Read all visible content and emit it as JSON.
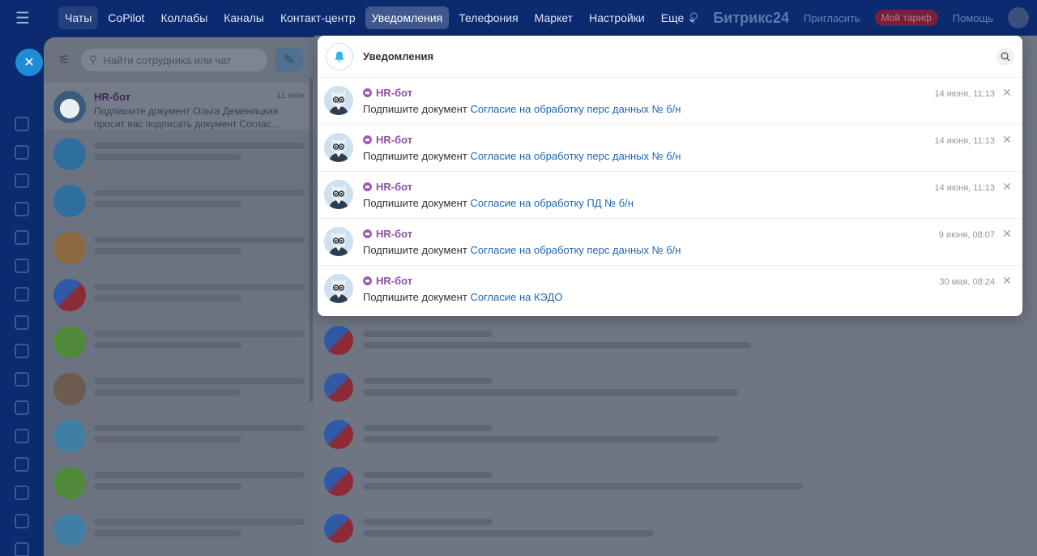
{
  "header": {
    "nav": [
      {
        "label": "Чаты"
      },
      {
        "label": "CoPilot"
      },
      {
        "label": "Коллабы"
      },
      {
        "label": "Каналы"
      },
      {
        "label": "Контакт-центр"
      },
      {
        "label": "Уведомления"
      },
      {
        "label": "Телефония"
      },
      {
        "label": "Маркет"
      },
      {
        "label": "Настройки"
      },
      {
        "label": "Еще"
      }
    ],
    "active_nav": "Уведомления",
    "brand": "Битрикс24",
    "invite_label": "Пригласить",
    "tariff_label": "Мой тариф",
    "help_label": "Помощь",
    "more_chevron": "⌄"
  },
  "chat_list": {
    "search_placeholder": "Найти сотрудника или чат",
    "first_chat": {
      "name": "HR-бот",
      "time": "11 июн",
      "snippet": "Подпишите документ Ольга Деменицкая просит вас подписать документ Соглас..."
    }
  },
  "notifications": {
    "title": "Уведомления",
    "items": [
      {
        "sender": "HR-бот",
        "prefix": "Подпишите документ",
        "link": "Согласие на обработку перс данных № б/н",
        "time": "14 июня, 11:13"
      },
      {
        "sender": "HR-бот",
        "prefix": "Подпишите документ",
        "link": "Согласие на обработку перс данных № б/н",
        "time": "14 июня, 11:13"
      },
      {
        "sender": "HR-бот",
        "prefix": "Подпишите документ",
        "link": "Согласие на обработку ПД № б/н",
        "time": "14 июня, 11:13"
      },
      {
        "sender": "HR-бот",
        "prefix": "Подпишите документ",
        "link": "Согласие на обработку перс данных № б/н",
        "time": "9 июня, 08:07"
      },
      {
        "sender": "HR-бот",
        "prefix": "Подпишите документ",
        "link": "Согласие на КЭДО",
        "time": "30 мая, 08:24"
      }
    ]
  },
  "colors": {
    "accent": "#2067b0",
    "bot_name": "#8d4fa3",
    "topbar": "#0b2a70"
  }
}
